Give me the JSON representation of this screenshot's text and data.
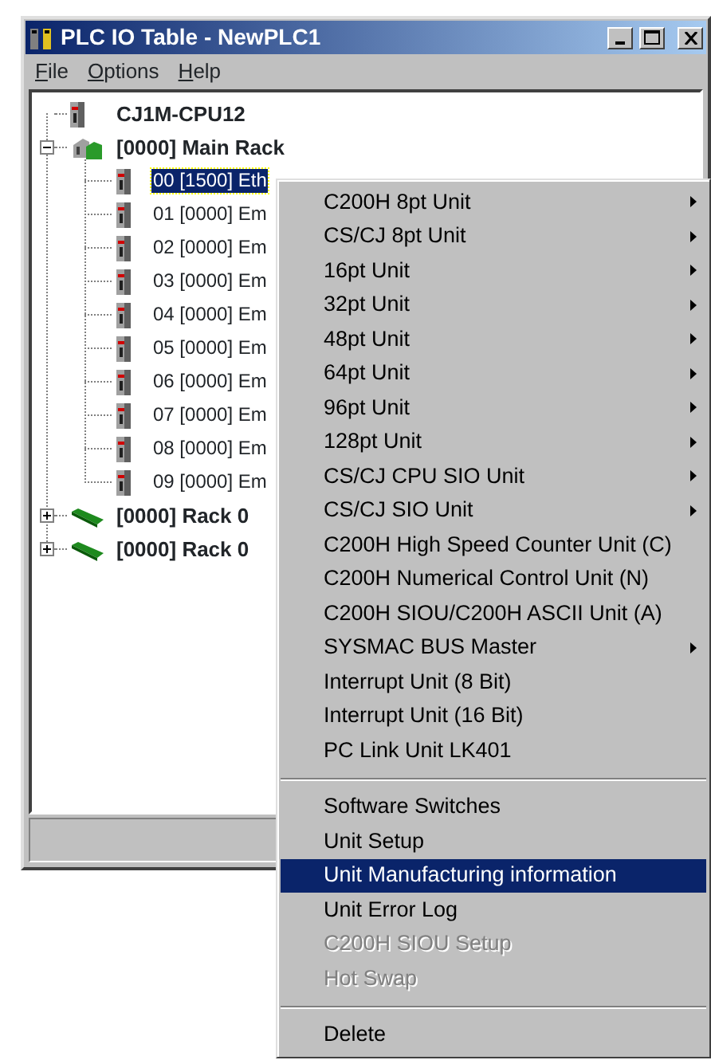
{
  "window": {
    "title": "PLC IO Table - NewPLC1"
  },
  "menu_bar": [
    {
      "mnemonic": "F",
      "rest": "ile"
    },
    {
      "mnemonic": "O",
      "rest": "ptions"
    },
    {
      "mnemonic": "H",
      "rest": "elp"
    }
  ],
  "tree": [
    {
      "label": "CJ1M-CPU12",
      "kind": "cpu",
      "selected": false
    },
    {
      "label": "[0000] Main Rack",
      "kind": "rack",
      "expanded": true,
      "selected": false,
      "children": [
        {
          "label": "00 [1500] Eth",
          "kind": "unit",
          "selected": true
        },
        {
          "label": "01 [0000] Em",
          "kind": "unit",
          "selected": false
        },
        {
          "label": "02 [0000] Em",
          "kind": "unit",
          "selected": false
        },
        {
          "label": "03 [0000] Em",
          "kind": "unit",
          "selected": false
        },
        {
          "label": "04 [0000] Em",
          "kind": "unit",
          "selected": false
        },
        {
          "label": "05 [0000] Em",
          "kind": "unit",
          "selected": false
        },
        {
          "label": "06 [0000] Em",
          "kind": "unit",
          "selected": false
        },
        {
          "label": "07 [0000] Em",
          "kind": "unit",
          "selected": false
        },
        {
          "label": "08 [0000] Em",
          "kind": "unit",
          "selected": false
        },
        {
          "label": "09 [0000] Em",
          "kind": "unit",
          "selected": false
        }
      ]
    },
    {
      "label": "[0000] Rack 0",
      "kind": "expansion",
      "expanded": false,
      "selected": false
    },
    {
      "label": "[0000] Rack 0",
      "kind": "expansion",
      "expanded": false,
      "selected": false
    }
  ],
  "context_menu": [
    {
      "kind": "item",
      "label": "C200H 8pt Unit",
      "submenu": true,
      "disabled": false,
      "selected": false
    },
    {
      "kind": "item",
      "label": "CS/CJ 8pt Unit",
      "submenu": true,
      "disabled": false,
      "selected": false
    },
    {
      "kind": "item",
      "label": "16pt Unit",
      "submenu": true,
      "disabled": false,
      "selected": false
    },
    {
      "kind": "item",
      "label": "32pt Unit",
      "submenu": true,
      "disabled": false,
      "selected": false
    },
    {
      "kind": "item",
      "label": "48pt Unit",
      "submenu": true,
      "disabled": false,
      "selected": false
    },
    {
      "kind": "item",
      "label": "64pt Unit",
      "submenu": true,
      "disabled": false,
      "selected": false
    },
    {
      "kind": "item",
      "label": "96pt Unit",
      "submenu": true,
      "disabled": false,
      "selected": false
    },
    {
      "kind": "item",
      "label": "128pt Unit",
      "submenu": true,
      "disabled": false,
      "selected": false
    },
    {
      "kind": "item",
      "label": "CS/CJ CPU SIO Unit",
      "submenu": true,
      "disabled": false,
      "selected": false
    },
    {
      "kind": "item",
      "label": "CS/CJ SIO Unit",
      "submenu": true,
      "disabled": false,
      "selected": false
    },
    {
      "kind": "item",
      "label": "C200H High Speed Counter Unit (C)",
      "submenu": false,
      "disabled": false,
      "selected": false
    },
    {
      "kind": "item",
      "label": "C200H Numerical Control Unit (N)",
      "submenu": false,
      "disabled": false,
      "selected": false
    },
    {
      "kind": "item",
      "label": "C200H SIOU/C200H ASCII Unit (A)",
      "submenu": false,
      "disabled": false,
      "selected": false
    },
    {
      "kind": "item",
      "label": "SYSMAC BUS Master",
      "submenu": true,
      "disabled": false,
      "selected": false
    },
    {
      "kind": "item",
      "label": "Interrupt Unit (8 Bit)",
      "submenu": false,
      "disabled": false,
      "selected": false
    },
    {
      "kind": "item",
      "label": "Interrupt Unit (16 Bit)",
      "submenu": false,
      "disabled": false,
      "selected": false
    },
    {
      "kind": "item",
      "label": "PC Link Unit LK401",
      "submenu": false,
      "disabled": false,
      "selected": false
    },
    {
      "kind": "separator"
    },
    {
      "kind": "item",
      "label": "Software Switches",
      "submenu": false,
      "disabled": false,
      "selected": false
    },
    {
      "kind": "item",
      "label": "Unit Setup",
      "submenu": false,
      "disabled": false,
      "selected": false
    },
    {
      "kind": "item",
      "label": "Unit Manufacturing information",
      "submenu": false,
      "disabled": false,
      "selected": true
    },
    {
      "kind": "item",
      "label": "Unit Error Log",
      "submenu": false,
      "disabled": false,
      "selected": false
    },
    {
      "kind": "item",
      "label": "C200H SIOU Setup",
      "submenu": false,
      "disabled": true,
      "selected": false
    },
    {
      "kind": "item",
      "label": "Hot Swap",
      "submenu": false,
      "disabled": true,
      "selected": false
    },
    {
      "kind": "separator"
    },
    {
      "kind": "item",
      "label": "Delete",
      "submenu": false,
      "disabled": false,
      "selected": false
    }
  ]
}
